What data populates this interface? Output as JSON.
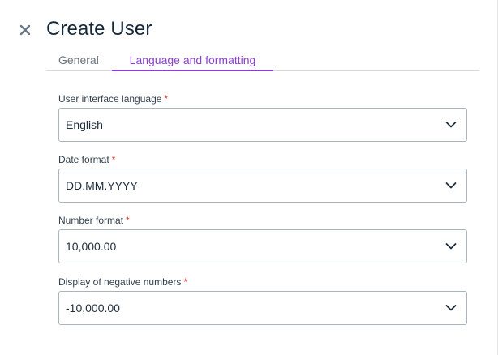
{
  "dialog": {
    "title": "Create User"
  },
  "tabs": [
    {
      "label": "General",
      "active": false
    },
    {
      "label": "Language and formatting",
      "active": true
    }
  ],
  "fields": [
    {
      "label": "User interface language",
      "required_mark": "*",
      "value": "English"
    },
    {
      "label": "Date format",
      "required_mark": "*",
      "value": "DD.MM.YYYY"
    },
    {
      "label": "Number format",
      "required_mark": "*",
      "value": "10,000.00"
    },
    {
      "label": "Display of negative numbers",
      "required_mark": "*",
      "value": "-10,000.00"
    }
  ],
  "icons": {
    "close": "close-icon",
    "dropdown": "chevron-down-icon"
  },
  "colors": {
    "accent": "#8a3fd1",
    "required": "#d93a2b",
    "title": "#13283a"
  }
}
